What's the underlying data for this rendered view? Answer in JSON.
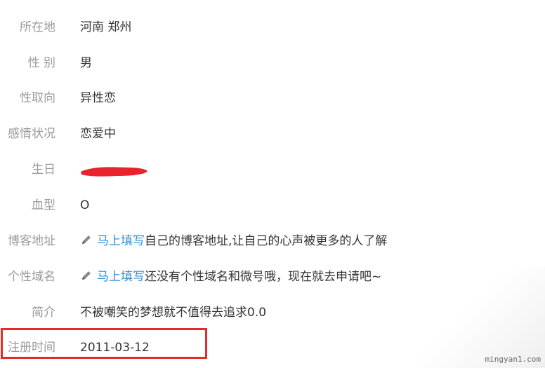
{
  "profile": {
    "location": {
      "label": "所在地",
      "value": "河南 郑州"
    },
    "gender": {
      "label": "性 别",
      "value": "男"
    },
    "orientation": {
      "label": "性取向",
      "value": "异性恋"
    },
    "relationship": {
      "label": "感情状况",
      "value": "恋爱中"
    },
    "birthday": {
      "label": "生日"
    },
    "blood_type": {
      "label": "血型",
      "value": "O"
    },
    "blog": {
      "label": "博客地址",
      "link": "马上填写",
      "text": "自己的博客地址,让自己的心声被更多的人了解"
    },
    "domain": {
      "label": "个性域名",
      "link": "马上填写",
      "text": "还没有个性域名和微号哦，现在就去申请吧~"
    },
    "bio": {
      "label": "简介",
      "value": "不被嘲笑的梦想就不值得去追求0.0"
    },
    "registered": {
      "label": "注册时间",
      "value": "2011-03-12"
    }
  },
  "colors": {
    "label": "#9a9a9a",
    "value": "#333333",
    "link": "#2b8fd3",
    "highlight": "#e32b2b",
    "redaction": "#e8232b"
  },
  "icons": {
    "edit": "pencil-icon"
  },
  "watermark": "mingyan1.com"
}
